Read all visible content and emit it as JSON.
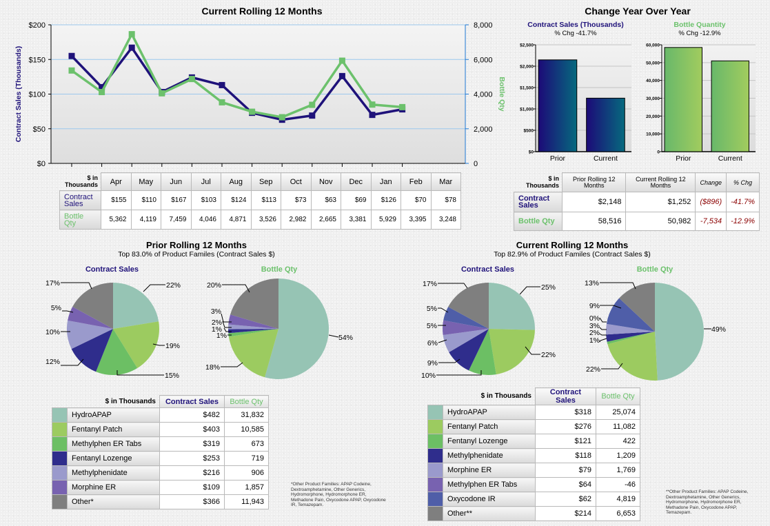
{
  "line_section": {
    "title": "Current Rolling 12 Months",
    "y_left_label": "Contract Sales (Thousands)",
    "y_right_label": "Bottle Qty",
    "table_corner": "$ in Thousands",
    "row_labels": [
      "Contract Sales",
      "Bottle Qty"
    ],
    "contract_sales_display": [
      "$155",
      "$110",
      "$167",
      "$103",
      "$124",
      "$113",
      "$73",
      "$63",
      "$69",
      "$126",
      "$70",
      "$78"
    ],
    "bottle_qty_display": [
      "5,362",
      "4,119",
      "7,459",
      "4,046",
      "4,871",
      "3,526",
      "2,982",
      "2,665",
      "3,381",
      "5,929",
      "3,395",
      "3,248"
    ]
  },
  "yoy_section": {
    "title": "Change Year Over Year",
    "sales_title": "Contract Sales (Thousands)",
    "sales_sub": "% Chg -41.7%",
    "qty_title": "Bottle Quantity",
    "qty_sub": "% Chg -12.9%",
    "table": {
      "corner": "$ in Thousands",
      "headers": [
        "Prior Rolling 12 Months",
        "Current Rolling 12 Months",
        "Change",
        "% Chg"
      ],
      "rows": [
        {
          "label": "Contract Sales",
          "prior": "$2,148",
          "current": "$1,252",
          "change": "($896)",
          "pct": "-41.7%"
        },
        {
          "label": "Bottle Qty",
          "prior": "58,516",
          "current": "50,982",
          "change": "-7,534",
          "pct": "-12.9%"
        }
      ]
    }
  },
  "prior_pies": {
    "title": "Prior Rolling 12 Months",
    "subtitle": "Top 83.0% of Product Familes (Contract Sales $)",
    "sales_label": "Contract Sales",
    "qty_label": "Bottle Qty",
    "legend": {
      "corner": "$ in Thousands",
      "col1": "Contract Sales",
      "col2": "Bottle Qty",
      "rows": [
        {
          "name": "HydroAPAP",
          "color": "#96c4b4",
          "sales": "$482",
          "qty": "31,832"
        },
        {
          "name": "Fentanyl Patch",
          "color": "#9ccb60",
          "sales": "$403",
          "qty": "10,585"
        },
        {
          "name": "Methylphen ER Tabs",
          "color": "#6cbf64",
          "sales": "$319",
          "qty": "673"
        },
        {
          "name": "Fentanyl Lozenge",
          "color": "#2f2d8c",
          "sales": "$253",
          "qty": "719"
        },
        {
          "name": "Methylphenidate",
          "color": "#9a9acc",
          "sales": "$216",
          "qty": "906"
        },
        {
          "name": "Morphine ER",
          "color": "#7862b0",
          "sales": "$109",
          "qty": "1,857"
        },
        {
          "name": "Other*",
          "color": "#7f7f7f",
          "sales": "$366",
          "qty": "11,943"
        }
      ]
    },
    "footnote": "*Other Product Families: APAP Codeine, Dextroamphetamine, Other Generics, Hydromorphone, Hydromorphone ER, Methadone Pain, Oxycodone APAP, Oxycodone IR, Temazepam."
  },
  "current_pies": {
    "title": "Current Rolling 12 Months",
    "subtitle": "Top 82.9% of Product Familes (Contract Sales $)",
    "sales_label": "Contract Sales",
    "qty_label": "Bottle Qty",
    "legend": {
      "corner": "$ in Thousands",
      "col1": "Contract Sales",
      "col2": "Bottle Qty",
      "rows": [
        {
          "name": "HydroAPAP",
          "color": "#96c4b4",
          "sales": "$318",
          "qty": "25,074"
        },
        {
          "name": "Fentanyl Patch",
          "color": "#9ccb60",
          "sales": "$276",
          "qty": "11,082"
        },
        {
          "name": "Fentanyl Lozenge",
          "color": "#6cbf64",
          "sales": "$121",
          "qty": "422"
        },
        {
          "name": "Methylphenidate",
          "color": "#2f2d8c",
          "sales": "$118",
          "qty": "1,209"
        },
        {
          "name": "Morphine ER",
          "color": "#9a9acc",
          "sales": "$79",
          "qty": "1,769"
        },
        {
          "name": "Methylphen ER Tabs",
          "color": "#7862b0",
          "sales": "$64",
          "qty": "-46"
        },
        {
          "name": "Oxycodone IR",
          "color": "#4f5ea8",
          "sales": "$62",
          "qty": "4,819"
        },
        {
          "name": "Other**",
          "color": "#7f7f7f",
          "sales": "$214",
          "qty": "6,653"
        }
      ]
    },
    "footnote": "**Other Product Families: APAP Codeine, Dextroamphetamine, Other Generics, Hydromorphone, Hydromorphone ER, Methadone Pain, Oxycodone APAP, Temazepam."
  },
  "chart_data": [
    {
      "type": "line",
      "title": "Current Rolling 12 Months",
      "categories": [
        "Apr",
        "May",
        "Jun",
        "Jul",
        "Aug",
        "Sep",
        "Oct",
        "Nov",
        "Dec",
        "Jan",
        "Feb",
        "Mar"
      ],
      "series": [
        {
          "name": "Contract Sales",
          "axis": "left",
          "color": "#1f127a",
          "values": [
            155,
            110,
            167,
            103,
            124,
            113,
            73,
            63,
            69,
            126,
            70,
            78
          ]
        },
        {
          "name": "Bottle Qty",
          "axis": "right",
          "color": "#6cc16c",
          "values": [
            5362,
            4119,
            7459,
            4046,
            4871,
            3526,
            2982,
            2665,
            3381,
            5929,
            3395,
            3248
          ]
        }
      ],
      "ylabel": "Contract Sales (Thousands)",
      "ylim": [
        0,
        200
      ],
      "yticks": [
        "$0",
        "$50",
        "$100",
        "$150",
        "$200"
      ],
      "y2label": "Bottle Qty",
      "y2lim": [
        0,
        8000
      ],
      "y2ticks": [
        "0",
        "2,000",
        "4,000",
        "6,000",
        "8,000"
      ],
      "grid": true
    },
    {
      "type": "bar",
      "title": "Contract Sales (Thousands)",
      "subtitle": "% Chg -41.7%",
      "categories": [
        "Prior",
        "Current"
      ],
      "values": [
        2148,
        1252
      ],
      "ylim": [
        0,
        2500
      ],
      "yticks": [
        "$0",
        "$500",
        "$1,000",
        "$1,500",
        "$2,000",
        "$2,500"
      ]
    },
    {
      "type": "bar",
      "title": "Bottle Quantity",
      "subtitle": "% Chg -12.9%",
      "categories": [
        "Prior",
        "Current"
      ],
      "values": [
        58516,
        50982
      ],
      "ylim": [
        0,
        60000
      ],
      "yticks": [
        "0",
        "10,000",
        "20,000",
        "30,000",
        "40,000",
        "50,000",
        "60,000"
      ]
    },
    {
      "type": "pie",
      "title": "Prior Rolling 12 Months - Contract Sales",
      "labels": [
        "HydroAPAP",
        "Fentanyl Patch",
        "Methylphen ER Tabs",
        "Fentanyl Lozenge",
        "Methylphenidate",
        "Morphine ER",
        "Other*"
      ],
      "values": [
        482,
        403,
        319,
        253,
        216,
        109,
        366
      ],
      "pct_labels": [
        "22%",
        "19%",
        "15%",
        "12%",
        "10%",
        "5%",
        "17%"
      ]
    },
    {
      "type": "pie",
      "title": "Prior Rolling 12 Months - Bottle Qty",
      "labels": [
        "HydroAPAP",
        "Fentanyl Patch",
        "Methylphen ER Tabs",
        "Fentanyl Lozenge",
        "Methylphenidate",
        "Morphine ER",
        "Other*"
      ],
      "values": [
        31832,
        10585,
        673,
        719,
        906,
        1857,
        11943
      ],
      "pct_labels": [
        "54%",
        "18%",
        "1%",
        "1%",
        "2%",
        "3%",
        "20%"
      ]
    },
    {
      "type": "pie",
      "title": "Current Rolling 12 Months - Contract Sales",
      "labels": [
        "HydroAPAP",
        "Fentanyl Patch",
        "Fentanyl Lozenge",
        "Methylphenidate",
        "Morphine ER",
        "Methylphen ER Tabs",
        "Oxycodone IR",
        "Other**"
      ],
      "values": [
        318,
        276,
        121,
        118,
        79,
        64,
        62,
        214
      ],
      "pct_labels": [
        "25%",
        "22%",
        "10%",
        "9%",
        "6%",
        "5%",
        "5%",
        "17%"
      ]
    },
    {
      "type": "pie",
      "title": "Current Rolling 12 Months - Bottle Qty",
      "labels": [
        "HydroAPAP",
        "Fentanyl Patch",
        "Fentanyl Lozenge",
        "Methylphenidate",
        "Morphine ER",
        "Methylphen ER Tabs",
        "Oxycodone IR",
        "Other**"
      ],
      "values": [
        25074,
        11082,
        422,
        1209,
        1769,
        0,
        4819,
        6653
      ],
      "pct_labels": [
        "49%",
        "22%",
        "1%",
        "2%",
        "3%",
        "0%",
        "9%",
        "13%"
      ]
    }
  ]
}
